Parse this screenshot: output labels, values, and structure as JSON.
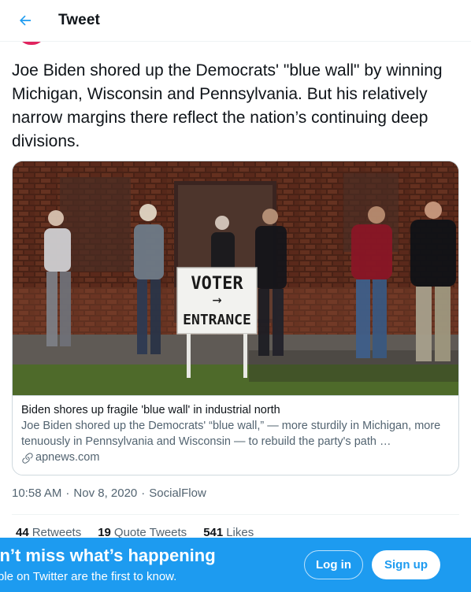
{
  "header": {
    "title": "Tweet",
    "back_icon": "arrow-left-icon",
    "accent_color": "#1d9bf0"
  },
  "tweet": {
    "text": "Joe Biden shored up the Democrats' \"blue wall\" by winning Michigan, Wisconsin and Pennsylvania. But his relatively narrow margins there reflect the nation’s continuing deep divisions.",
    "card": {
      "photo_sign_line1": "VOTER",
      "photo_sign_arrow": "→",
      "photo_sign_line2": "ENTRANCE",
      "title": "Biden shores up fragile 'blue wall' in industrial north",
      "description": "Joe Biden shored up the Democrats' “blue wall,” — more sturdily in Michigan, more tenuously in Pennsylvania and Wisconsin — to rebuild the party's path …",
      "domain": "apnews.com",
      "domain_icon": "link-icon"
    },
    "time": "10:58 AM",
    "date": "Nov 8, 2020",
    "source": "SocialFlow",
    "separator": "·",
    "stats": {
      "retweets_count": "44",
      "retweets_label": "Retweets",
      "quotes_count": "19",
      "quotes_label": "Quote Tweets",
      "likes_count": "541",
      "likes_label": "Likes"
    }
  },
  "banner": {
    "headline": "on’t miss what’s happening",
    "subtext": "ple on Twitter are the first to know.",
    "login_label": "Log in",
    "signup_label": "Sign up",
    "background_color": "#1d9bf0"
  }
}
